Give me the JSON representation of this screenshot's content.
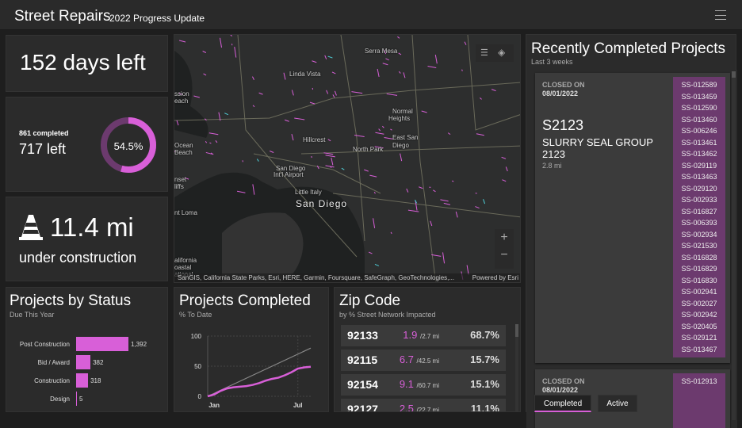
{
  "header": {
    "title": "Street Repairs",
    "subtitle": "2022 Progress Update"
  },
  "days": {
    "text": "152 days left"
  },
  "progress": {
    "completed": "861 completed",
    "left": "717 left",
    "percent_label": "54.5%",
    "percent": 54.5
  },
  "construction": {
    "miles": "11.4 mi",
    "label": "under construction"
  },
  "map": {
    "labels": [
      "Serra Mesa",
      "Linda Vista",
      "ssion\neach",
      "Normal",
      "Heights",
      "Hillcrest",
      "East San",
      "Diego",
      "North Park",
      "Ocean",
      "Beach",
      "San Diego",
      "Int'l Airport",
      "Little Italy",
      "San Diego",
      "nt Loma",
      "nset",
      "liffs",
      "alifornia",
      "oastal",
      "ational"
    ],
    "attribution": "SanGIS, California State Parks, Esri, HERE, Garmin, Foursquare, SafeGraph, GeoTechnologies,...",
    "powered": "Powered by Esri",
    "colors": {
      "highlight": "#d85fd8",
      "accent": "#4fd1d9"
    }
  },
  "recent": {
    "title": "Recently Completed Projects",
    "subtitle": "Last 3 weeks",
    "cards": [
      {
        "closed_label": "CLOSED ON",
        "date": "08/01/2022",
        "code": "S2123",
        "name": "SLURRY SEAL GROUP 2123",
        "length": "2.8 mi",
        "ids": [
          "SS-012589",
          "SS-013459",
          "SS-012590",
          "SS-013460",
          "SS-006246",
          "SS-013461",
          "SS-013462",
          "SS-029119",
          "SS-013463",
          "SS-029120",
          "SS-002933",
          "SS-016827",
          "SS-006393",
          "SS-002934",
          "SS-021530",
          "SS-016828",
          "SS-016829",
          "SS-016830",
          "SS-002941",
          "SS-002027",
          "SS-002942",
          "SS-020405",
          "SS-029121",
          "SS-013467"
        ]
      },
      {
        "closed_label": "CLOSED ON",
        "date": "08/01/2022",
        "ids": [
          "SS-012913"
        ]
      }
    ],
    "tabs": [
      "Completed",
      "Active"
    ]
  },
  "status": {
    "title": "Projects by Status",
    "subtitle": "Due This Year"
  },
  "completed_chart": {
    "title": "Projects Completed",
    "subtitle": "% To Date"
  },
  "zip": {
    "title": "Zip Code",
    "subtitle": "by % Street Network Impacted",
    "rows": [
      {
        "zip": "92133",
        "mi": "1.9",
        "total": "/2.7 mi",
        "pct": "68.7%"
      },
      {
        "zip": "92115",
        "mi": "6.7",
        "total": "/42.5 mi",
        "pct": "15.7%"
      },
      {
        "zip": "92154",
        "mi": "9.1",
        "total": "/60.7 mi",
        "pct": "15.1%"
      },
      {
        "zip": "92127",
        "mi": "2.5",
        "total": "/22.7 mi",
        "pct": "11.1%"
      }
    ]
  },
  "chart_data": [
    {
      "type": "bar",
      "title": "Projects by Status",
      "subtitle": "Due This Year",
      "categories": [
        "Post Construction",
        "Bid / Award",
        "Construction",
        "Design"
      ],
      "values": [
        1392,
        382,
        318,
        5
      ],
      "value_labels": [
        "1,392",
        "382",
        "318",
        "5"
      ]
    },
    {
      "type": "line",
      "title": "Projects Completed",
      "subtitle": "% To Date",
      "ylim": [
        0,
        100
      ],
      "yticks": [
        "0",
        "50",
        "100"
      ],
      "xticks": [
        "Jan",
        "Jul"
      ],
      "series": [
        {
          "name": "target",
          "x": [
            0,
            8
          ],
          "y": [
            0,
            80
          ]
        },
        {
          "name": "actual",
          "x": [
            0,
            0.5,
            1,
            1.5,
            2,
            2.5,
            3,
            3.5,
            4,
            4.5,
            5,
            5.5,
            6,
            6.5,
            7,
            7.5,
            8
          ],
          "y": [
            0,
            3,
            9,
            13,
            15,
            16,
            17,
            19,
            22,
            26,
            29,
            31,
            35,
            40,
            46,
            48,
            49
          ]
        }
      ]
    }
  ]
}
